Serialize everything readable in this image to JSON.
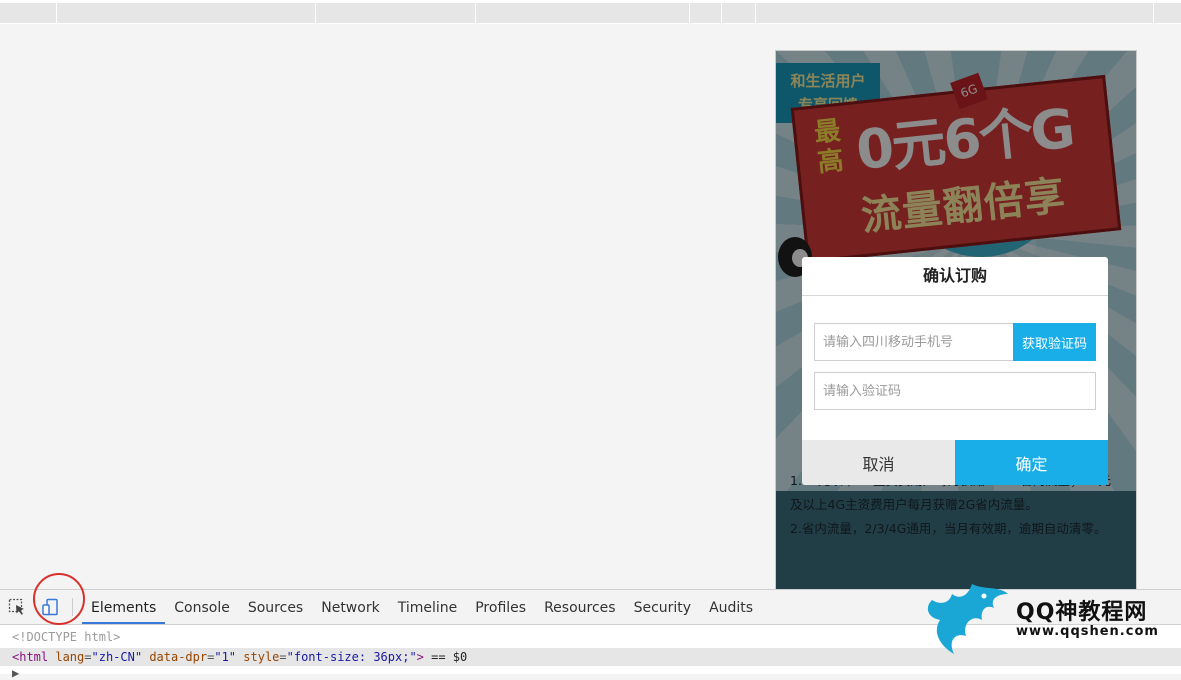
{
  "phone_page": {
    "badge": [
      "和生活用户",
      "专享回馈"
    ],
    "banner": {
      "line1": "最高",
      "line2": "0元6个G",
      "line3": "流量翻倍享",
      "tag": "6G"
    },
    "rules": [
      "1.88元以下4G主资费用户每月获赠500M省内流量；88元及以上4G主资费用户每月获赠2G省内流量。",
      "2.省内流量，2/3/4G通用，当月有效期，逾期自动清零。"
    ]
  },
  "modal": {
    "title": "确认订购",
    "phone_placeholder": "请输入四川移动手机号",
    "get_code_label": "获取验证码",
    "code_placeholder": "请输入验证码",
    "cancel_label": "取消",
    "confirm_label": "确定"
  },
  "devtools": {
    "tabs": [
      "Elements",
      "Console",
      "Sources",
      "Network",
      "Timeline",
      "Profiles",
      "Resources",
      "Security",
      "Audits"
    ],
    "active_tab": "Elements",
    "doctype": "<!DOCTYPE html>",
    "html_line": {
      "open": "<html",
      "attr1": "lang",
      "val1": "\"zh-CN\"",
      "attr2": "data-dpr",
      "val2": "\"1\"",
      "attr3": "style",
      "val3": "\"font-size: 36px;\"",
      "close": ">",
      "suffix": " == $0"
    }
  },
  "watermark": {
    "name": "QQ神教程网",
    "url": "www.qqshen.com"
  },
  "colors": {
    "accent": "#1aaee8",
    "annotation": "#d9302c",
    "tab_underline": "#3879d9"
  }
}
